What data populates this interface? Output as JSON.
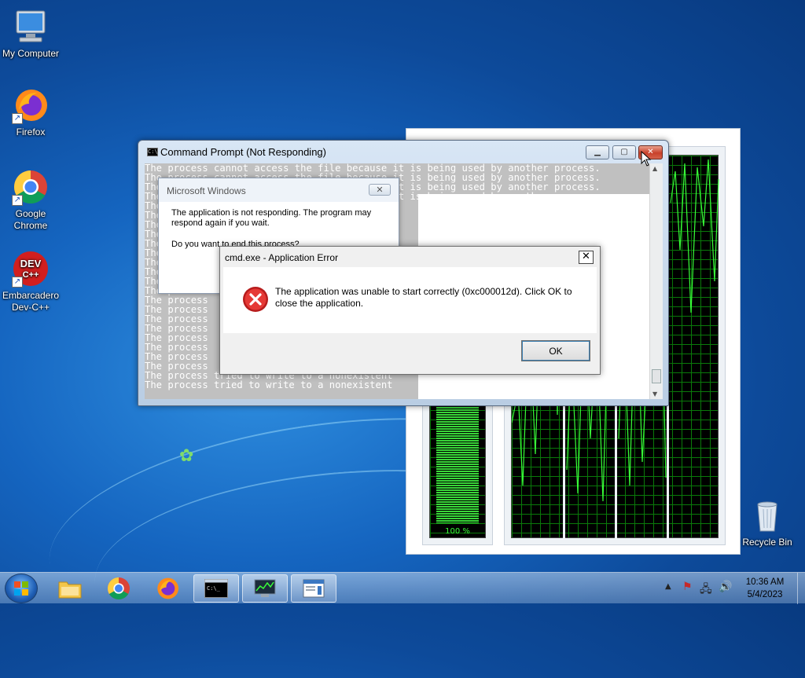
{
  "desktop": {
    "icons": [
      {
        "label": "My Computer"
      },
      {
        "label": "Firefox"
      },
      {
        "label": "Google Chrome"
      },
      {
        "label": "Embarcadero Dev-C++"
      },
      {
        "label": "Recycle Bin"
      }
    ],
    "devcpp_logo": "DEV C++"
  },
  "task_manager": {
    "cpu_usage_label": "100 %"
  },
  "cmd_window": {
    "title": "Command Prompt (Not Responding)",
    "lines": [
      "The process cannot access the file because it is being used by another process.",
      "The process cannot access the file because it is being used by another process.",
      "The process cannot access the file because it is being used by another process.",
      "The process cannot access the file because it is being used by another process.",
      "The process",
      "The process",
      "The process",
      "The process",
      "The process",
      "The process",
      "The process",
      "The process",
      "The process",
      "The process",
      "The process",
      "The process",
      "The process",
      "The process",
      "The process",
      "The process",
      "The process",
      "The process",
      "The process tried to write to a nonexistent",
      "The process tried to write to a nonexistent"
    ]
  },
  "mswin_dialog": {
    "title": "Microsoft Windows",
    "message": "The application is not responding. The program may respond again if you wait.",
    "question": "Do you want to end this process?"
  },
  "app_error": {
    "title": "cmd.exe - Application Error",
    "message": "The application was unable to start correctly (0xc000012d). Click OK to close the application.",
    "ok_label": "OK",
    "close_glyph": "✕"
  },
  "taskbar": {
    "clock_time": "10:36 AM",
    "clock_date": "5/4/2023"
  },
  "colors": {
    "error_red": "#cc2222",
    "console_bg": "#c0c0c0",
    "graph_green": "#39ff39"
  }
}
